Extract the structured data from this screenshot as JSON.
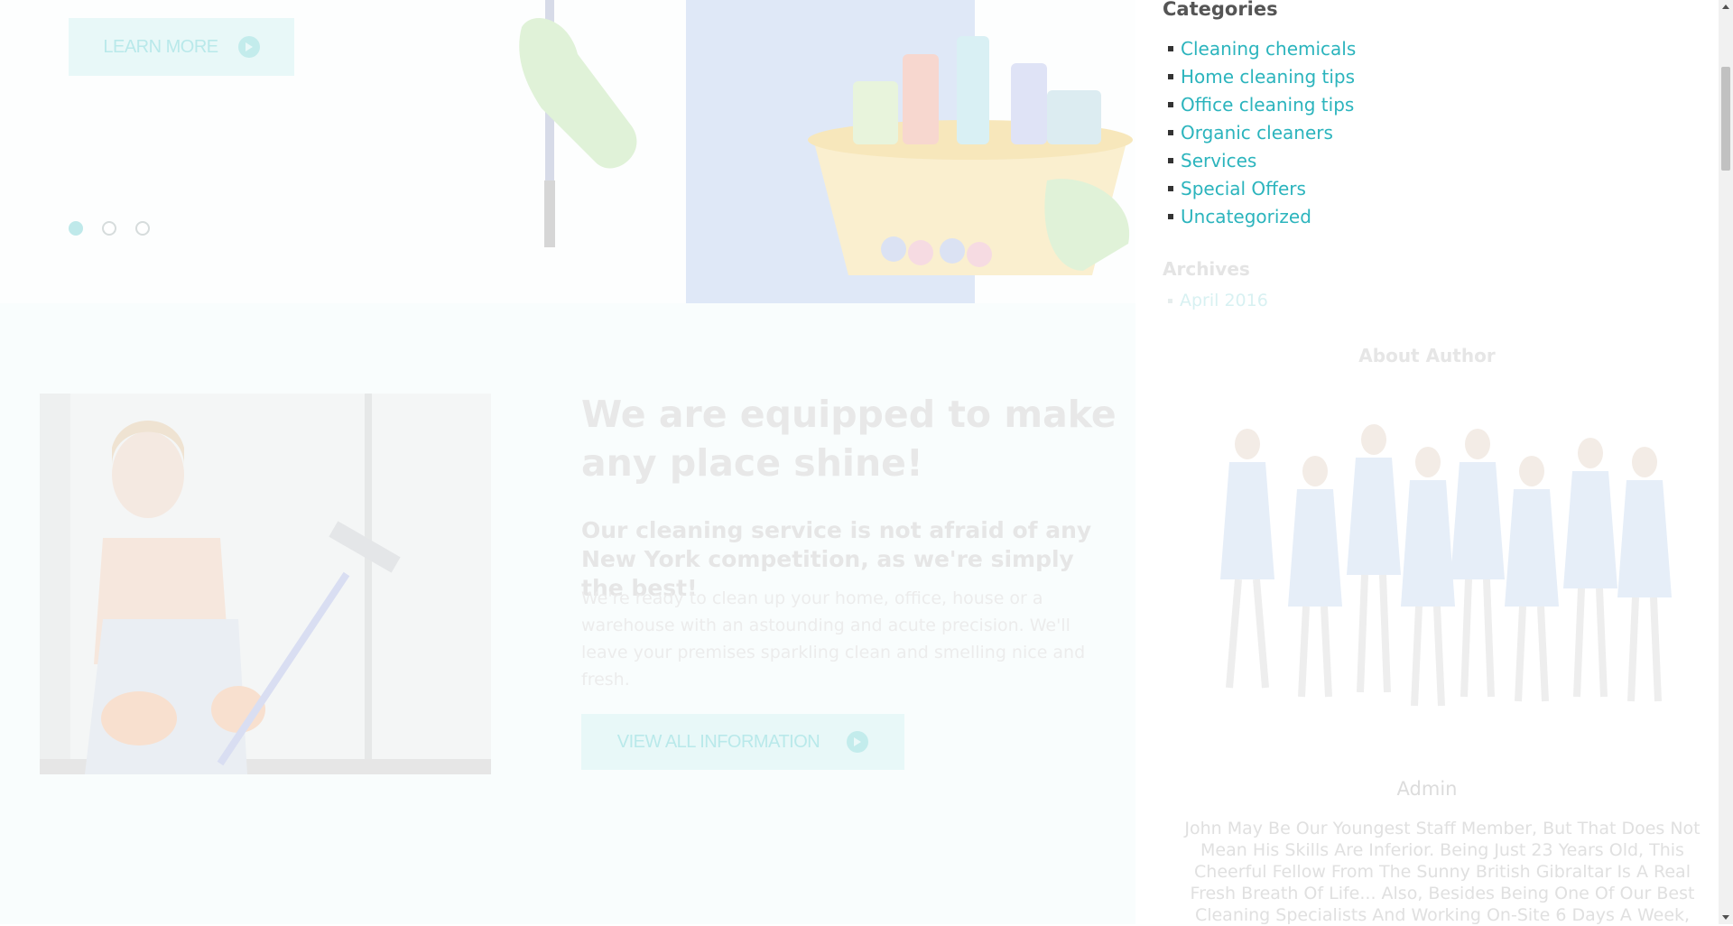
{
  "hero": {
    "learn_more_label": "LEARN MORE",
    "slider_dots": 3
  },
  "about": {
    "headline": "We are equipped to make any place shine!",
    "subheadline": "Our cleaning service is not afraid of any New York competition, as we're simply the best!",
    "body": "We're ready to clean up your home, office, house or a warehouse with an astounding and acute precision. We'll leave your premises sparkling clean and smelling nice and fresh.",
    "button_label": "VIEW ALL INFORMATION"
  },
  "sidebar": {
    "categories_title": "Categories",
    "categories": [
      {
        "label": "Cleaning chemicals"
      },
      {
        "label": "Home cleaning tips"
      },
      {
        "label": "Office cleaning tips"
      },
      {
        "label": "Organic cleaners"
      },
      {
        "label": "Services"
      },
      {
        "label": "Special Offers"
      },
      {
        "label": "Uncategorized"
      }
    ],
    "archives_title": "Archives",
    "archives": [
      {
        "label": "April 2016"
      }
    ],
    "author_title": "About Author",
    "author_name": "Admin",
    "author_bio": "John May Be Our Youngest Staff Member, But That Does Not Mean His Skills Are Inferior. Being Just 23 Years Old, This Cheerful Fellow From The Sunny British Gibraltar Is A Real Fresh Breath Of Life... Also, Besides Being One Of Our Best Cleaning Specialists And Working On-Site 6 Days A Week,"
  },
  "colors": {
    "accent": "#2bb4bd",
    "faded_accent": "#e8f8f8"
  }
}
